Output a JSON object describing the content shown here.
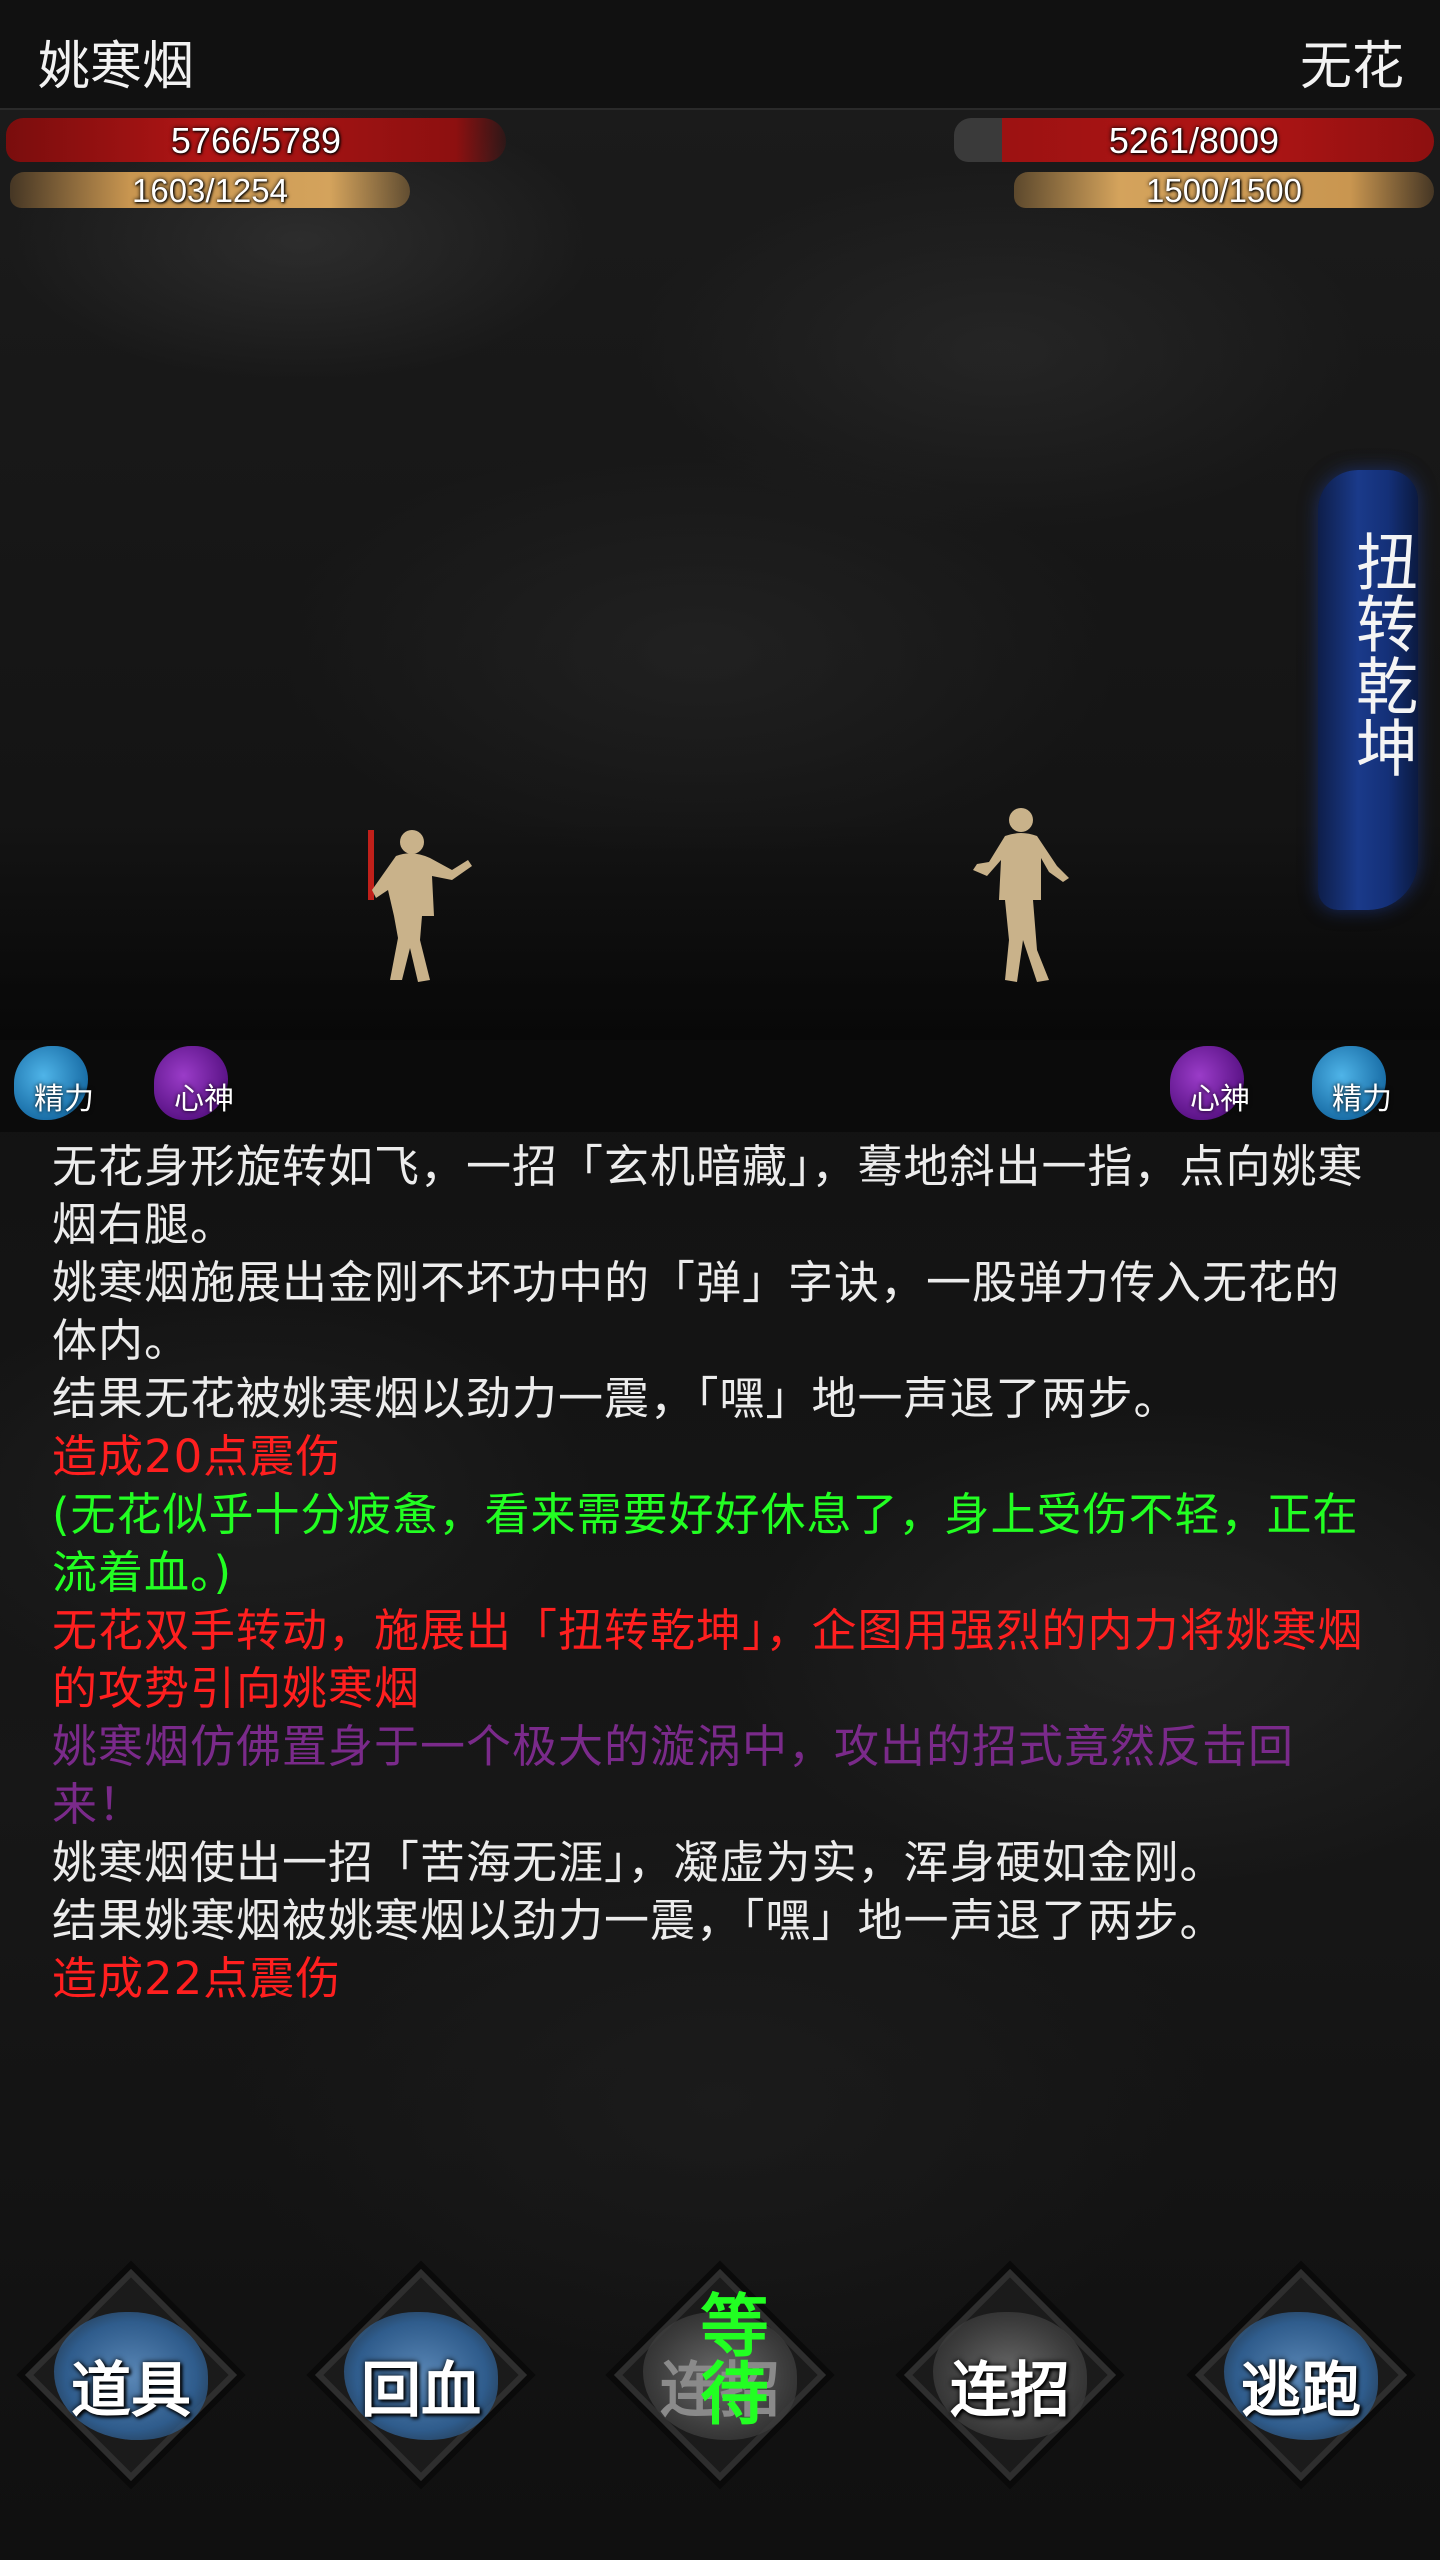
{
  "player": {
    "name": "姚寒烟",
    "hp": "5766/5789",
    "mp": "1603/1254",
    "status": {
      "stamina_label": "精力",
      "spirit_label": "心神"
    }
  },
  "enemy": {
    "name": "无花",
    "hp": "5261/8009",
    "mp": "1500/1500",
    "status": {
      "stamina_label": "精力",
      "spirit_label": "心神"
    }
  },
  "skill_banner": "扭转乾坤",
  "log": [
    {
      "text": "无花身形旋转如飞，一招「玄机暗藏」，蓦地斜出一指，点向姚寒烟右腿。",
      "color": "white"
    },
    {
      "text": "姚寒烟施展出金刚不坏功中的「弹」字诀，一股弹力传入无花的体内。",
      "color": "white"
    },
    {
      "text": "结果无花被姚寒烟以劲力一震，「嘿」地一声退了两步。",
      "color": "white"
    },
    {
      "text": "造成20点震伤",
      "color": "red"
    },
    {
      "text": "(无花似乎十分疲惫，看来需要好好休息了，身上受伤不轻，正在流着血。)",
      "color": "green"
    },
    {
      "text": "无花双手转动，施展出「扭转乾坤」，企图用强烈的内力将姚寒烟的攻势引向姚寒烟",
      "color": "red"
    },
    {
      "text": "姚寒烟仿佛置身于一个极大的漩涡中，攻出的招式竟然反击回来！",
      "color": "purple"
    },
    {
      "text": "姚寒烟使出一招「苦海无涯」，凝虚为实，浑身硬如金刚。",
      "color": "white"
    },
    {
      "text": "结果姚寒烟被姚寒烟以劲力一震，「嘿」地一声退了两步。",
      "color": "white"
    },
    {
      "text": "造成22点震伤",
      "color": "red"
    }
  ],
  "buttons": {
    "items": "道具",
    "heal": "回血",
    "combo_disabled": "连招",
    "wait": "等待",
    "combo": "连招",
    "flee": "逃跑"
  }
}
